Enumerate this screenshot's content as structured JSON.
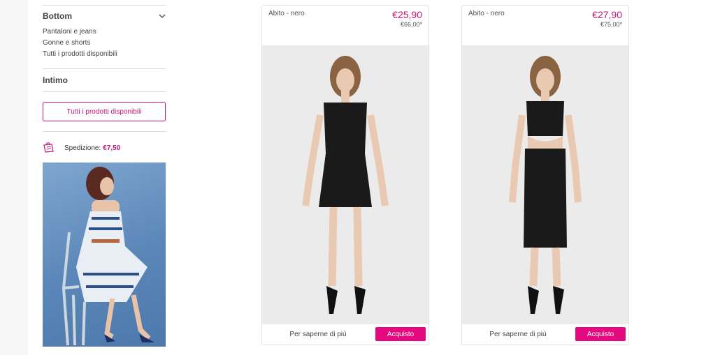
{
  "sidebar": {
    "bottom": {
      "title": "Bottom",
      "items": [
        "Pantaloni e jeans",
        "Gonne e shorts",
        "Tutti i prodotti disponibili"
      ]
    },
    "intimo_title": "Intimo",
    "all_products_button": "Tutti i prodotti disponibili",
    "shipping": {
      "label": "Spedizione:",
      "price": "€7,50"
    }
  },
  "products": [
    {
      "name": "Abito - nero",
      "price": "€25,90",
      "old_price": "€66,00*",
      "learn_more": "Per saperne di più",
      "buy": "Acquisto"
    },
    {
      "name": "Abito - nero",
      "price": "€27,90",
      "old_price": "€75,00*",
      "learn_more": "Per saperne di più",
      "buy": "Acquisto"
    }
  ],
  "colors": {
    "accent": "#e5097f",
    "accent_text": "#c2187a"
  },
  "icons": [
    "chevron-down-icon",
    "shopping-bag-icon"
  ]
}
